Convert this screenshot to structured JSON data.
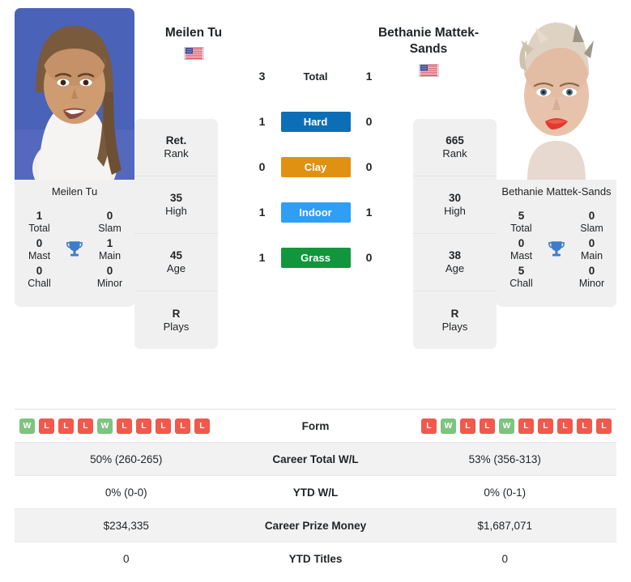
{
  "colors": {
    "hard": "#0d6eb8",
    "clay": "#e09112",
    "indoor": "#2f9ef5",
    "grass": "#12963c",
    "win": "#7cc47f",
    "loss": "#f0594c",
    "trophy": "#3d7cc9",
    "card_bg": "#f0f0f0",
    "row_alt": "#f2f2f2"
  },
  "players": {
    "left": {
      "name": "Meilen Tu",
      "photo_caption": "Meilen Tu",
      "country": "USA",
      "titles": {
        "total_value": "1",
        "total_label": "Total",
        "slam_value": "0",
        "slam_label": "Slam",
        "mast_value": "0",
        "mast_label": "Mast",
        "main_value": "1",
        "main_label": "Main",
        "chall_value": "0",
        "chall_label": "Chall",
        "minor_value": "0",
        "minor_label": "Minor"
      },
      "ranks": [
        {
          "value": "Ret.",
          "label": "Rank"
        },
        {
          "value": "35",
          "label": "High"
        },
        {
          "value": "45",
          "label": "Age"
        },
        {
          "value": "R",
          "label": "Plays"
        }
      ],
      "form": [
        "W",
        "L",
        "L",
        "L",
        "W",
        "L",
        "L",
        "L",
        "L",
        "L"
      ],
      "career_total_wl": "50% (260-265)",
      "ytd_wl": "0% (0-0)",
      "career_prize_money": "$234,335",
      "ytd_titles": "0"
    },
    "right": {
      "name": "Bethanie Mattek-Sands",
      "photo_caption": "Bethanie Mattek-Sands",
      "country": "USA",
      "titles": {
        "total_value": "5",
        "total_label": "Total",
        "slam_value": "0",
        "slam_label": "Slam",
        "mast_value": "0",
        "mast_label": "Mast",
        "main_value": "0",
        "main_label": "Main",
        "chall_value": "5",
        "chall_label": "Chall",
        "minor_value": "0",
        "minor_label": "Minor"
      },
      "ranks": [
        {
          "value": "665",
          "label": "Rank"
        },
        {
          "value": "30",
          "label": "High"
        },
        {
          "value": "38",
          "label": "Age"
        },
        {
          "value": "R",
          "label": "Plays"
        }
      ],
      "form": [
        "L",
        "W",
        "L",
        "L",
        "W",
        "L",
        "L",
        "L",
        "L",
        "L"
      ],
      "career_total_wl": "53% (356-313)",
      "ytd_wl": "0% (0-1)",
      "career_prize_money": "$1,687,071",
      "ytd_titles": "0"
    }
  },
  "head_to_head": [
    {
      "label": "Total",
      "left": "3",
      "right": "1",
      "style": "plain"
    },
    {
      "label": "Hard",
      "left": "1",
      "right": "0",
      "style": "hard"
    },
    {
      "label": "Clay",
      "left": "0",
      "right": "0",
      "style": "clay"
    },
    {
      "label": "Indoor",
      "left": "1",
      "right": "1",
      "style": "indoor"
    },
    {
      "label": "Grass",
      "left": "1",
      "right": "0",
      "style": "grass"
    }
  ],
  "stats_rows": [
    {
      "label": "Form",
      "left": "",
      "right": "",
      "type": "form"
    },
    {
      "label": "Career Total W/L",
      "left": "50% (260-265)",
      "right": "53% (356-313)",
      "type": "text"
    },
    {
      "label": "YTD W/L",
      "left": "0% (0-0)",
      "right": "0% (0-1)",
      "type": "text"
    },
    {
      "label": "Career Prize Money",
      "left": "$234,335",
      "right": "$1,687,071",
      "type": "text"
    },
    {
      "label": "YTD Titles",
      "left": "0",
      "right": "0",
      "type": "text"
    }
  ]
}
